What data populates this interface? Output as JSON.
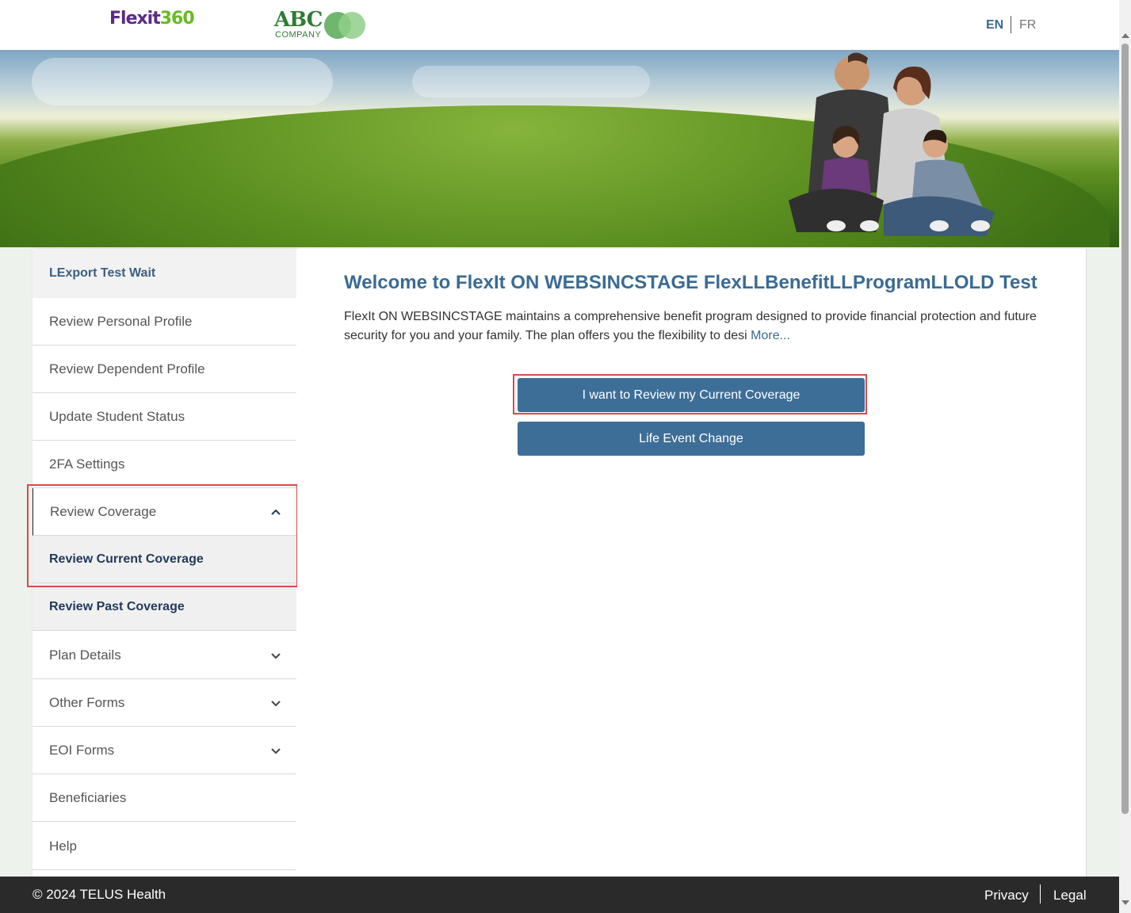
{
  "header": {
    "logo_flexit_a": "Flexit",
    "logo_flexit_b": "360",
    "logo_abc": "ABC",
    "logo_abc_sub": "COMPANY",
    "lang_en": "EN",
    "lang_fr": "FR"
  },
  "sidebar": {
    "user": "LExport Test Wait",
    "items": [
      {
        "label": "Review Personal Profile"
      },
      {
        "label": "Review Dependent Profile"
      },
      {
        "label": "Update Student Status"
      },
      {
        "label": "2FA Settings"
      },
      {
        "label": "Review Coverage",
        "expanded": true,
        "icon": "chevron-up-icon"
      },
      {
        "label": "Review Current Coverage",
        "sub": true,
        "active": true
      },
      {
        "label": "Review Past Coverage",
        "sub": true
      },
      {
        "label": "Plan Details",
        "icon": "chevron-down-icon"
      },
      {
        "label": "Other Forms",
        "icon": "chevron-down-icon"
      },
      {
        "label": "EOI Forms",
        "icon": "chevron-down-icon"
      },
      {
        "label": "Beneficiaries"
      },
      {
        "label": "Help"
      }
    ]
  },
  "main": {
    "welcome": "Welcome to FlexIt ON WEBSINCSTAGE FlexLLBenefitLLProgramLLOLD Test",
    "intro": "FlexIt ON WEBSINCSTAGE maintains a comprehensive benefit program designed to provide financial protection and future security for you and your family.  The plan offers you the flexibility to desi ",
    "more": "More...",
    "btn_review": "I want to Review my Current Coverage",
    "btn_life_event": "Life Event Change"
  },
  "footer": {
    "copyright": "© 2024 TELUS Health",
    "privacy": "Privacy",
    "legal": "Legal"
  },
  "colors": {
    "accent": "#3d6e98",
    "highlight": "#e0464e",
    "footer_bg": "#2a2a2a"
  }
}
